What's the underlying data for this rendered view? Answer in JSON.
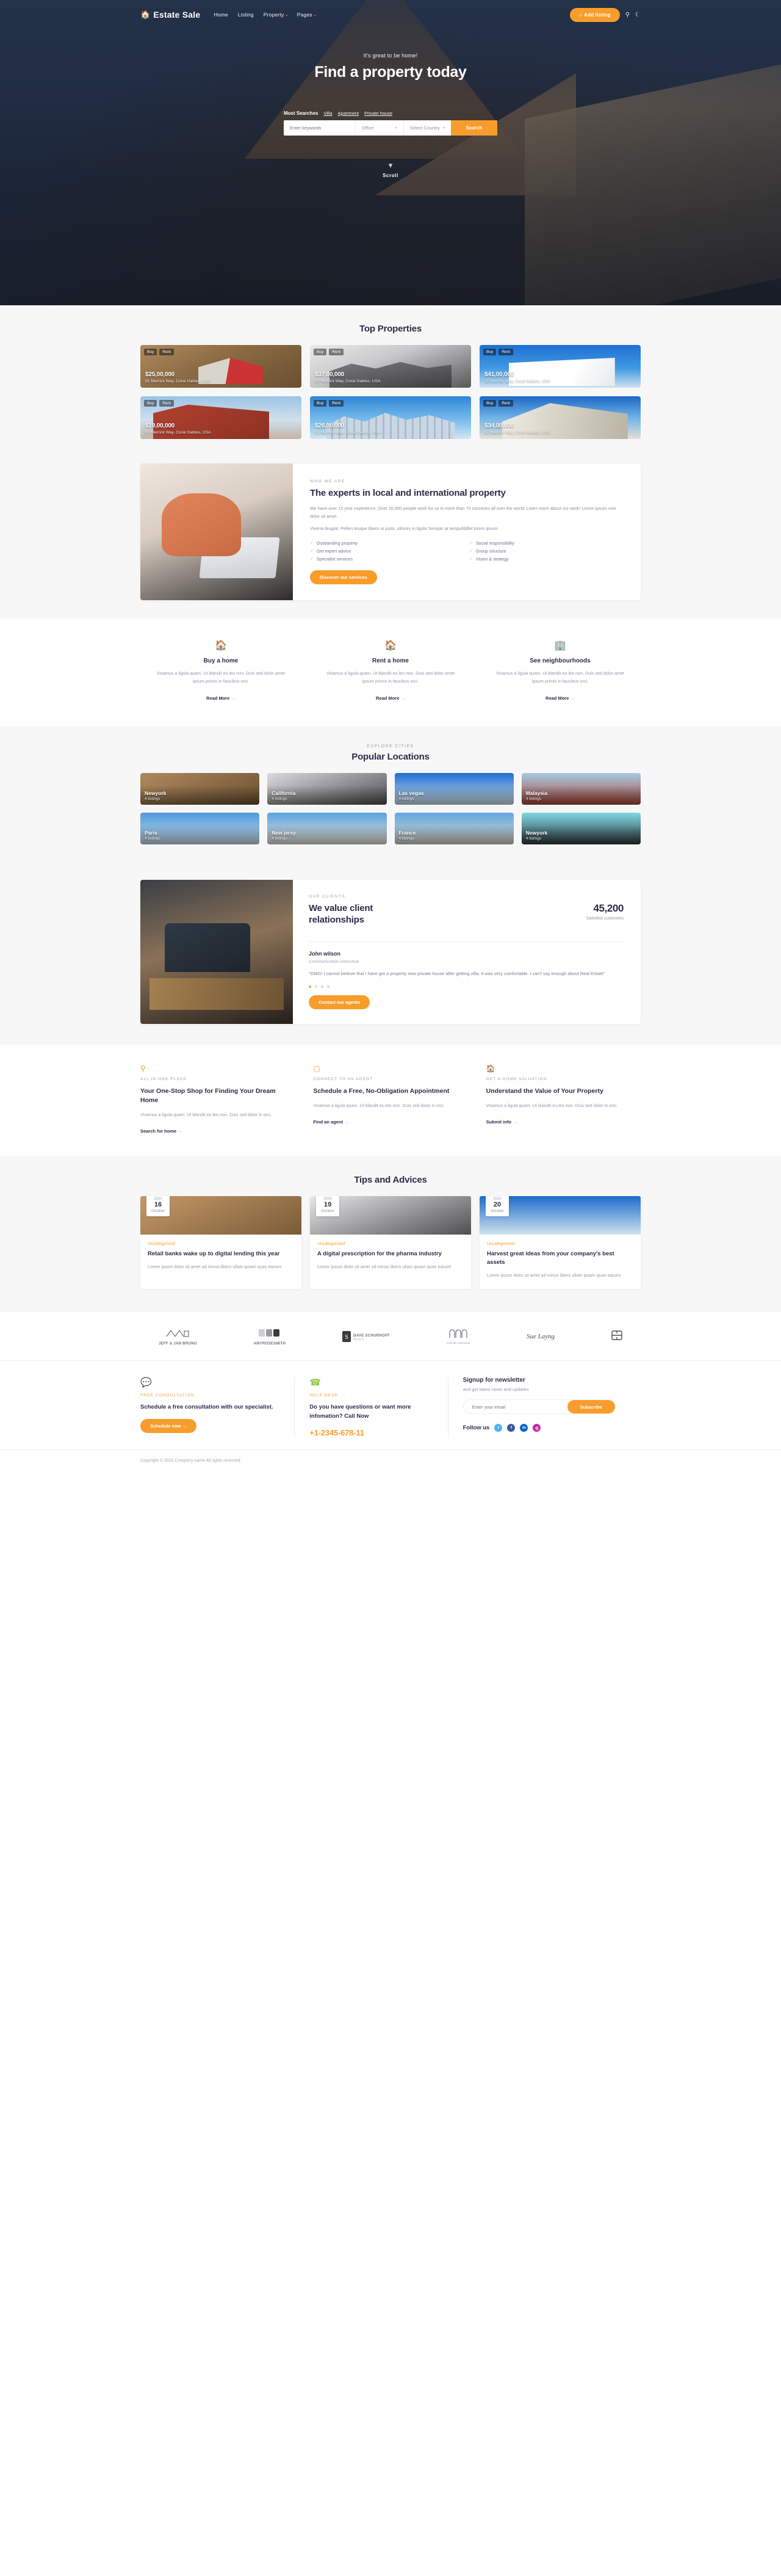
{
  "header": {
    "brand": "Estate Sale",
    "brand_icon": "home-icon",
    "nav": [
      {
        "label": "Home",
        "caret": ""
      },
      {
        "label": "Listing",
        "caret": ""
      },
      {
        "label": "Property",
        "caret": "⌄"
      },
      {
        "label": "Pages",
        "caret": "⌄"
      }
    ],
    "add_listing": "Add listing",
    "add_listing_icon": "plus-home-icon",
    "search_icon": "search-icon",
    "theme_icon": "moon-icon"
  },
  "hero": {
    "subtitle": "It's great to be home!",
    "title": "Find a property today",
    "most_searches_label": "Most Searches",
    "most_searches": [
      "Villa",
      "Apartment",
      "Private house"
    ],
    "keyword_placeholder": "Enter keywords",
    "type_value": "Office",
    "country_value": "Select Country",
    "search_button": "Search",
    "scroll_label": "Scroll"
  },
  "top_properties": {
    "title": "Top Properties",
    "tags": [
      "Buy",
      "Rent"
    ],
    "items": [
      {
        "price": "$25,00,000",
        "address": "51 Merrick Way, Coral Gables, USA"
      },
      {
        "price": "$37,00,000",
        "address": "51 Merrick Way, Coral Gables, USA"
      },
      {
        "price": "$41,00,000",
        "address": "51 Merrick Way, Coral Gables, USA"
      },
      {
        "price": "$19,00,000",
        "address": "51 Merrick Way, Coral Gables, USA"
      },
      {
        "price": "$26,00,000",
        "address": "51 Merrick Way, Coral Gables, USA"
      },
      {
        "price": "$34,00,000",
        "address": "51 Merrick Way, Coral Gables, USA"
      }
    ]
  },
  "who_we_are": {
    "kicker": "WHO WE ARE",
    "title": "The experts in local and international property",
    "p1": "We have over 15 year experience, Over 20,000 people work for us in more than 70 countries all over the world. Learn more about our work! Lorem ipsum vive dolor sit amet.",
    "p2": "Viverra feugiat. Pellen tesque libero ut justo, ultrices in ligula Semper at tempufddfel lorem ipsum.",
    "checks": [
      "Outstanding property",
      "Social responsibility",
      "Get expert advice",
      "Group structure",
      "Specialist services",
      "Vision & strategy"
    ],
    "cta": "Discover our services"
  },
  "features": [
    {
      "icon": "home-icon",
      "title": "Buy a home",
      "text": "Vivamus a ligula quam. Ut blandit eu leo non. Duis sed dolor amet ipsum primis in faucibus orci.",
      "link": "Read More"
    },
    {
      "icon": "home-icon",
      "title": "Rent a home",
      "text": "Vivamus a ligula quam. Ut blandit eu leo non. Duis sed dolor amet ipsum primis in faucibus orci.",
      "link": "Read More"
    },
    {
      "icon": "building-icon",
      "title": "See neighbourhoods",
      "text": "Vivamus a ligula quam. Ut blandit eu leo non. Duis sed dolor amet ipsum primis in faucibus orci.",
      "link": "Read More"
    }
  ],
  "locations": {
    "eyebrow": "EXPLORE CITIES",
    "title": "Popular Locations",
    "items": [
      {
        "name": "Newyork",
        "count": "4 listings"
      },
      {
        "name": "California",
        "count": "4 listings"
      },
      {
        "name": "Las vegas",
        "count": "4 listings"
      },
      {
        "name": "Malaysia",
        "count": "4 listings"
      },
      {
        "name": "Paris",
        "count": "4 listings"
      },
      {
        "name": "New jersy",
        "count": "4 listings"
      },
      {
        "name": "France",
        "count": "4 listings"
      },
      {
        "name": "Newyork",
        "count": "4 listings"
      }
    ]
  },
  "testimonial": {
    "kicker": "OUR CLIENTS",
    "title": "We value client relationships",
    "stat_number": "45,200",
    "stat_label": "Satisfied customers",
    "name": "John wilson",
    "role": "Communication executive",
    "quote": "\"OMG! I cannot believe that I have got a property new private house after getting villa. It was very comfortable. I can't say enough about Real Estate\"",
    "cta": "Contact our agents",
    "dots": 4,
    "active_dot": 0
  },
  "services": [
    {
      "icon": "search-badge-icon",
      "label": "ALL IN ONE PLACE",
      "title": "Your One-Stop Shop for Finding Your Dream Home",
      "text": "Vivamus a ligula quam. Ut blandit eu leo non. Duis sed dolor in orci.",
      "link": "Search for home"
    },
    {
      "icon": "chat-bubble-icon",
      "label": "CONNECT TO AN AGENT",
      "title": "Schedule a Free, No-Obligation Appointment",
      "text": "Vivamus a ligula quam. Ut blandit eu leo non. Duis sed dolor in orci.",
      "link": "Find an agent"
    },
    {
      "icon": "home-icon",
      "label": "GET A HOME VALUATION",
      "title": "Understand the Value of Your Property",
      "text": "Vivamus a ligula quam. Ut blandit eu leo non. Duis sed dolor in orci.",
      "link": "Submit info"
    }
  ],
  "blog": {
    "title": "Tips and Advices",
    "posts": [
      {
        "year": "2020",
        "day": "16",
        "month": "October",
        "category": "Uncategorized",
        "title": "Retail banks wake up to digital lending this year",
        "excerpt": "Lorem ipsum dolor sit amet ad minus libero ullam ipsam quas earum!"
      },
      {
        "year": "2020",
        "day": "19",
        "month": "October",
        "category": "Uncategorized",
        "title": "A digital prescription for the pharma industry",
        "excerpt": "Lorem ipsum dolor sit amet ad minus libero ullam ipsam quas earum!"
      },
      {
        "year": "2020",
        "day": "20",
        "month": "October",
        "category": "Uncategorized",
        "title": "Harvest great ideas from your company's best assets",
        "excerpt": "Lorem ipsum dolor sit amet ad minus libero ullam ipsam quas earum!"
      }
    ]
  },
  "partners": [
    {
      "name": "JEFF & JAN BRUNO",
      "sub": ""
    },
    {
      "name": "AMYROSESMITH",
      "sub": ""
    },
    {
      "name": "DAVE SCHURHOFF",
      "sub": "REALTY"
    },
    {
      "name": "michelle robichaud",
      "sub": ""
    },
    {
      "name": "Sue Layng",
      "sub": ""
    },
    {
      "name": "",
      "sub": ""
    }
  ],
  "footer": {
    "consultation": {
      "icon": "chat-icon",
      "label": "FREE CONSULTATION",
      "text": "Schedule a free consultation with our specialist.",
      "button": "Schedule now"
    },
    "helpdesk": {
      "icon": "phone-icon",
      "label": "HELP DESK",
      "text": "Do you have questions or want more infomation? Call Now",
      "phone": "+1-2345-678-11"
    },
    "newsletter": {
      "title": "Signup for newsletter",
      "subtitle": "and get latest news and updates",
      "placeholder": "Enter your email",
      "button": "Subscribe",
      "follow_label": "Follow us",
      "socials": [
        {
          "name": "twitter",
          "glyph": "t",
          "color": "#4eb3ee"
        },
        {
          "name": "facebook",
          "glyph": "f",
          "color": "#3b5998"
        },
        {
          "name": "linkedin",
          "glyph": "in",
          "color": "#0a66c2"
        },
        {
          "name": "instagram",
          "glyph": "◎",
          "color": "#c32aa3"
        }
      ]
    },
    "copyright": "Copyright © 2020.Company name All rights reserved."
  },
  "colors": {
    "accent": "#f89d2c",
    "dark": "#2b2d4a",
    "muted": "#9499a7",
    "green": "#8cc63f"
  }
}
